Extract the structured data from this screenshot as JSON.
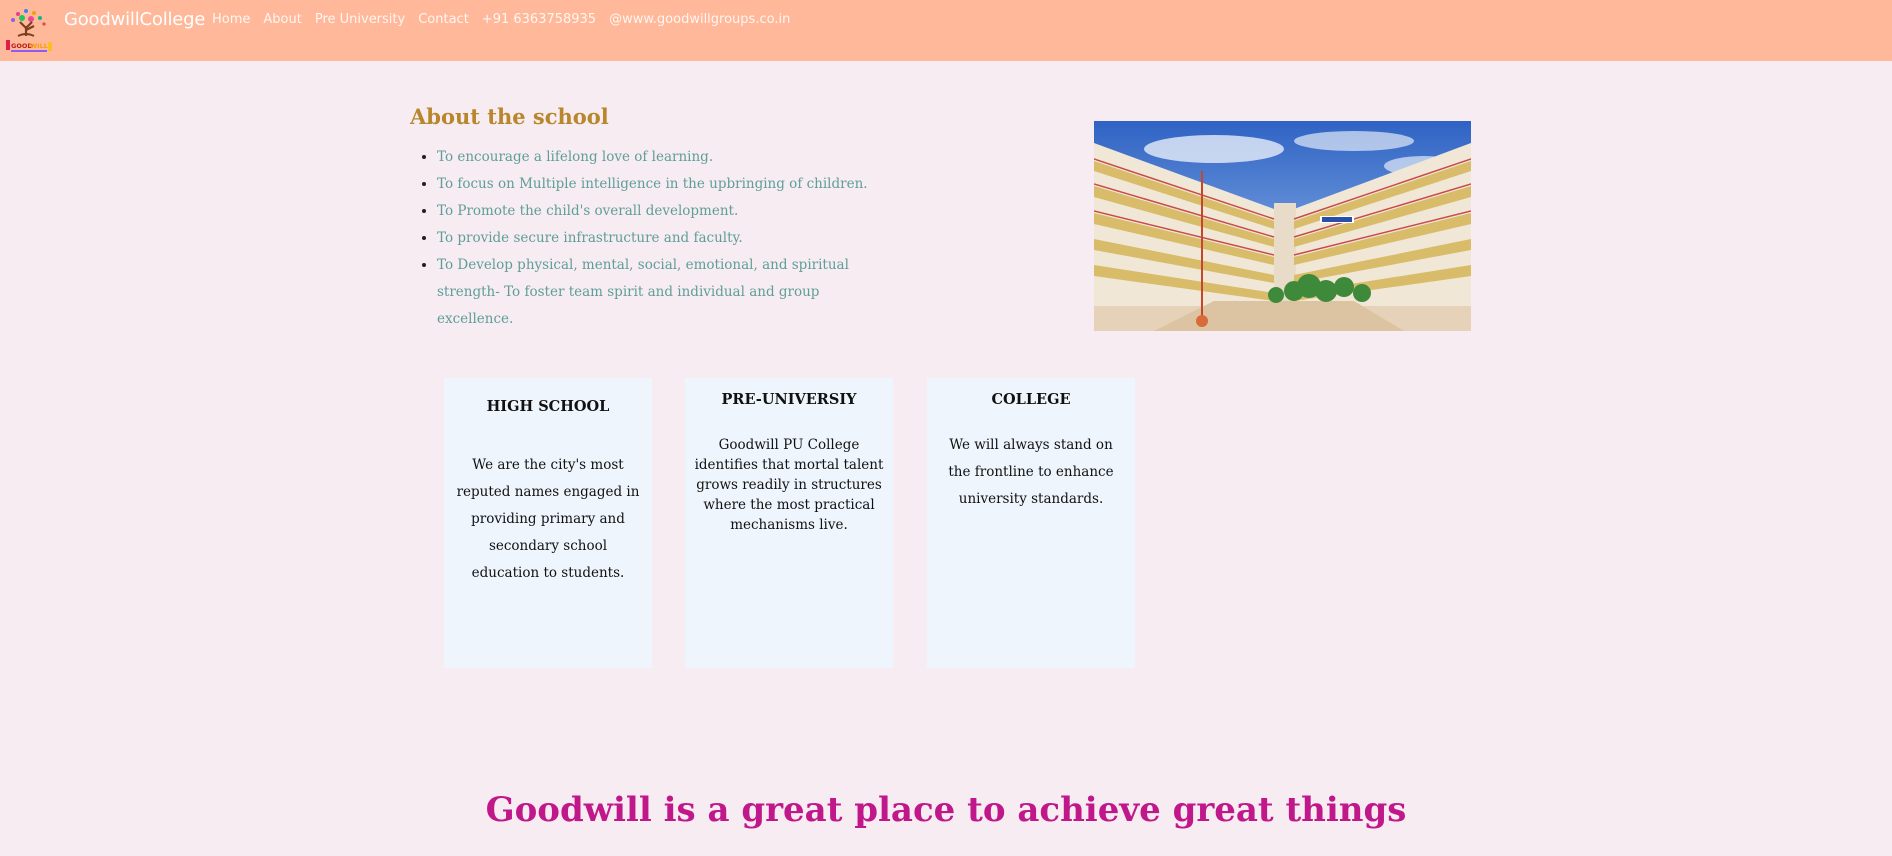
{
  "navbar": {
    "brand": "GoodwillCollege",
    "links": [
      "Home",
      "About",
      "Pre University",
      "Contact",
      "+91 6363758935",
      "@www.goodwillgroups.co.in"
    ]
  },
  "about": {
    "title": "About the school",
    "items": [
      "To encourage a lifelong love of learning.",
      "To focus on Multiple intelligence in the upbringing of children.",
      "To Promote the child's overall development.",
      "To provide secure infrastructure and faculty.",
      "To Develop physical, mental, social, emotional, and spiritual strength- To foster team spirit and individual and group excellence."
    ]
  },
  "cards": [
    {
      "title": "HIGH SCHOOL",
      "text": "We are the city's most reputed names engaged in providing primary and secondary school education to students."
    },
    {
      "title": "PRE-UNIVERSIY",
      "text": "Goodwill PU College identifies that mortal talent grows readily in structures where the most practical mechanisms live."
    },
    {
      "title": "COLLEGE",
      "text": "We will always stand on the frontline to enhance university standards."
    }
  ],
  "tagline": "Goodwill is a great place to achieve great things",
  "colors": {
    "navbar_bg": "#ffb89a",
    "page_bg": "#f7ecf1",
    "about_title": "#b8862b",
    "about_text": "#5e9e9a",
    "card_bg": "#eff5fd",
    "tagline": "#c0188a"
  }
}
